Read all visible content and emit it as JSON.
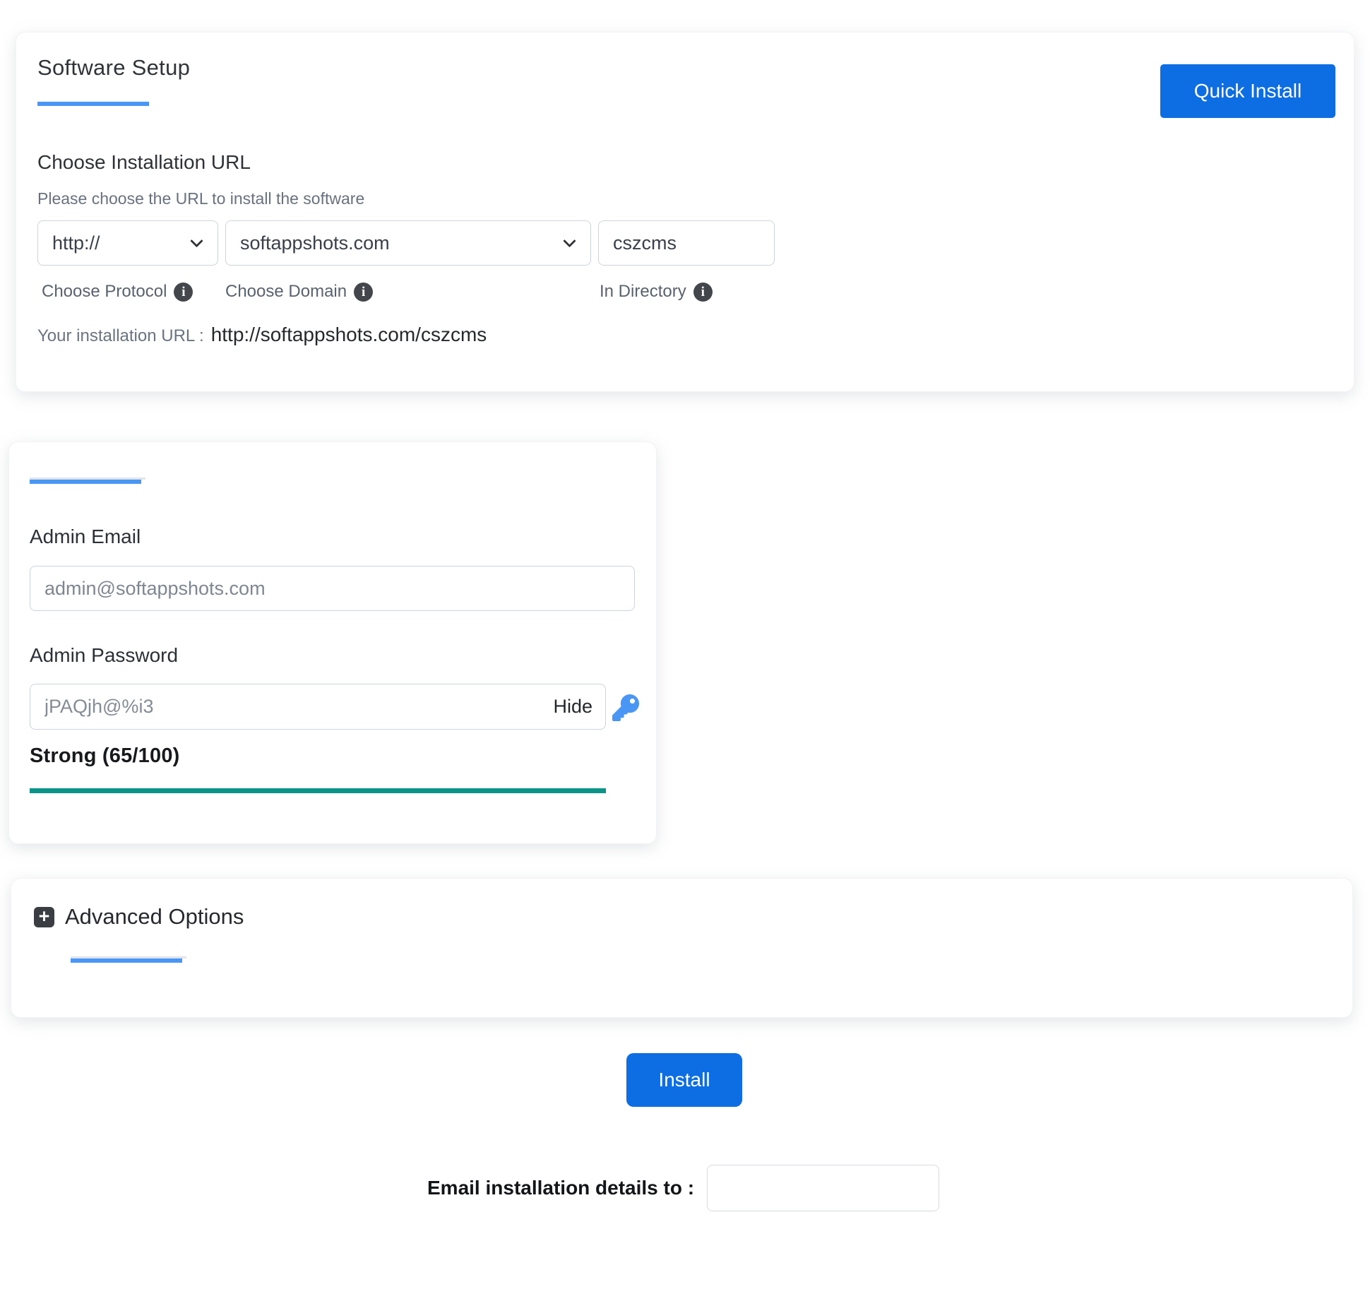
{
  "software_setup": {
    "title": "Software Setup",
    "quick_install_button": "Quick Install",
    "section": {
      "heading": "Choose Installation URL",
      "subheading": "Please choose the URL to install the software"
    },
    "protocol_select": {
      "value": "http://",
      "label": "Choose Protocol"
    },
    "domain_select": {
      "value": "softappshots.com",
      "label": "Choose Domain"
    },
    "directory_input": {
      "value": "cszcms",
      "label": "In Directory"
    },
    "installation_url": {
      "label": "Your installation URL :",
      "value": "http://softappshots.com/cszcms"
    }
  },
  "admin": {
    "email": {
      "label": "Admin Email",
      "value": "admin@softappshots.com"
    },
    "password": {
      "label": "Admin Password",
      "value": "jPAQjh@%i3",
      "toggle_label": "Hide"
    },
    "strength": {
      "text": "Strong (65/100)",
      "score": 65,
      "max": 100
    }
  },
  "advanced_options": {
    "heading": "Advanced Options"
  },
  "actions": {
    "install_button": "Install"
  },
  "email_details": {
    "label": "Email installation details to :",
    "value": ""
  },
  "colors": {
    "primary_button": "#0d6ee4",
    "accent_underline": "#4a96f5",
    "strength_bar": "#0b9488",
    "info_icon": "#43474c"
  }
}
